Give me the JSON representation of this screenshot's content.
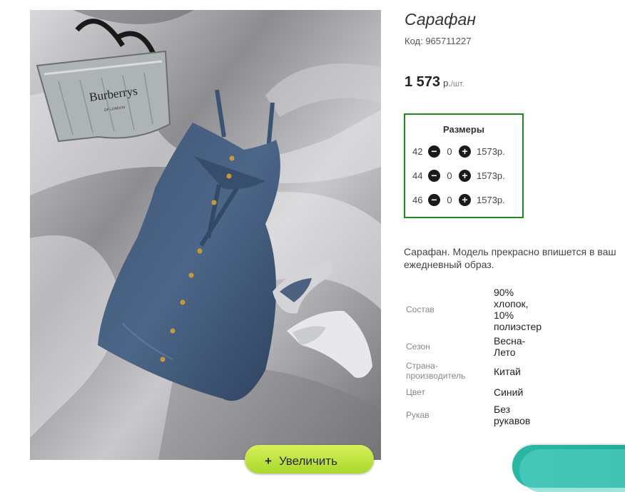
{
  "product": {
    "title": "Сарафан",
    "sku": "Код: 965711227",
    "price": "1 573",
    "currency": "р.",
    "unit": "/шт."
  },
  "photo": {
    "bag_brand": "Burberrys",
    "bag_subtext": "OF LONDON",
    "zoom_label": "Увеличить",
    "zoom_icon": "+"
  },
  "sizes": {
    "title": "Размеры",
    "rows": [
      {
        "size": "42",
        "qty": "0",
        "price": "1573р."
      },
      {
        "size": "44",
        "qty": "0",
        "price": "1573р."
      },
      {
        "size": "46",
        "qty": "0",
        "price": "1573р."
      }
    ]
  },
  "description": "Сарафан. Модель прекрасно впишется в ваш ежедневный образ.",
  "specs": [
    {
      "label": "Состав",
      "value": "90% хлопок, 10% полиэстер"
    },
    {
      "label": "Сезон",
      "value": "Весна-Лето"
    },
    {
      "label": "Страна-производитель",
      "value": "Китай"
    },
    {
      "label": "Цвет",
      "value": "Синий"
    },
    {
      "label": "Рукав",
      "value": "Без рукавов"
    }
  ],
  "colors": {
    "sizes_border": "#1d8a1d",
    "zoom_button": "#b5e13a",
    "teal_accent": "#2bb7a6"
  }
}
